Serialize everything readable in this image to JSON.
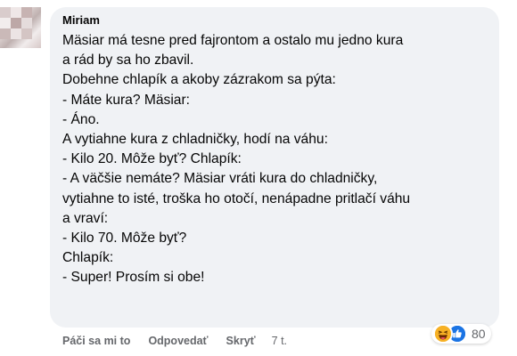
{
  "comment": {
    "author": "Miriam",
    "lines": [
      "Mäsiar má tesne pred fajrontom a ostalo mu jedno kura",
      "a rád by sa ho zbavil.",
      "Dobehne chlapík a akoby zázrakom sa pýta:",
      "- Máte kura? Mäsiar:",
      "- Áno.",
      "A vytiahne kura z chladničky, hodí na váhu:",
      "- Kilo 20. Môže byť? Chlapík:",
      "- A väčšie nemáte? Mäsiar vráti kura do chladničky,",
      "vytiahne to isté, troška ho otočí, nenápadne pritlačí váhu",
      "a vraví:",
      "- Kilo 70. Môže byť?",
      "Chlapík:",
      "- Super! Prosím si obe!"
    ]
  },
  "reactions": {
    "icons": [
      "haha-icon",
      "like-icon"
    ],
    "count": "80"
  },
  "actions": {
    "like": "Páči sa mi to",
    "reply": "Odpovedať",
    "hide": "Skryť",
    "time": "7 t."
  },
  "colors": {
    "bubble": "#f0f2f5",
    "text": "#050505",
    "secondary": "#65676b",
    "like_blue": "#1b74e4",
    "haha_yellow": "#f7b125"
  }
}
